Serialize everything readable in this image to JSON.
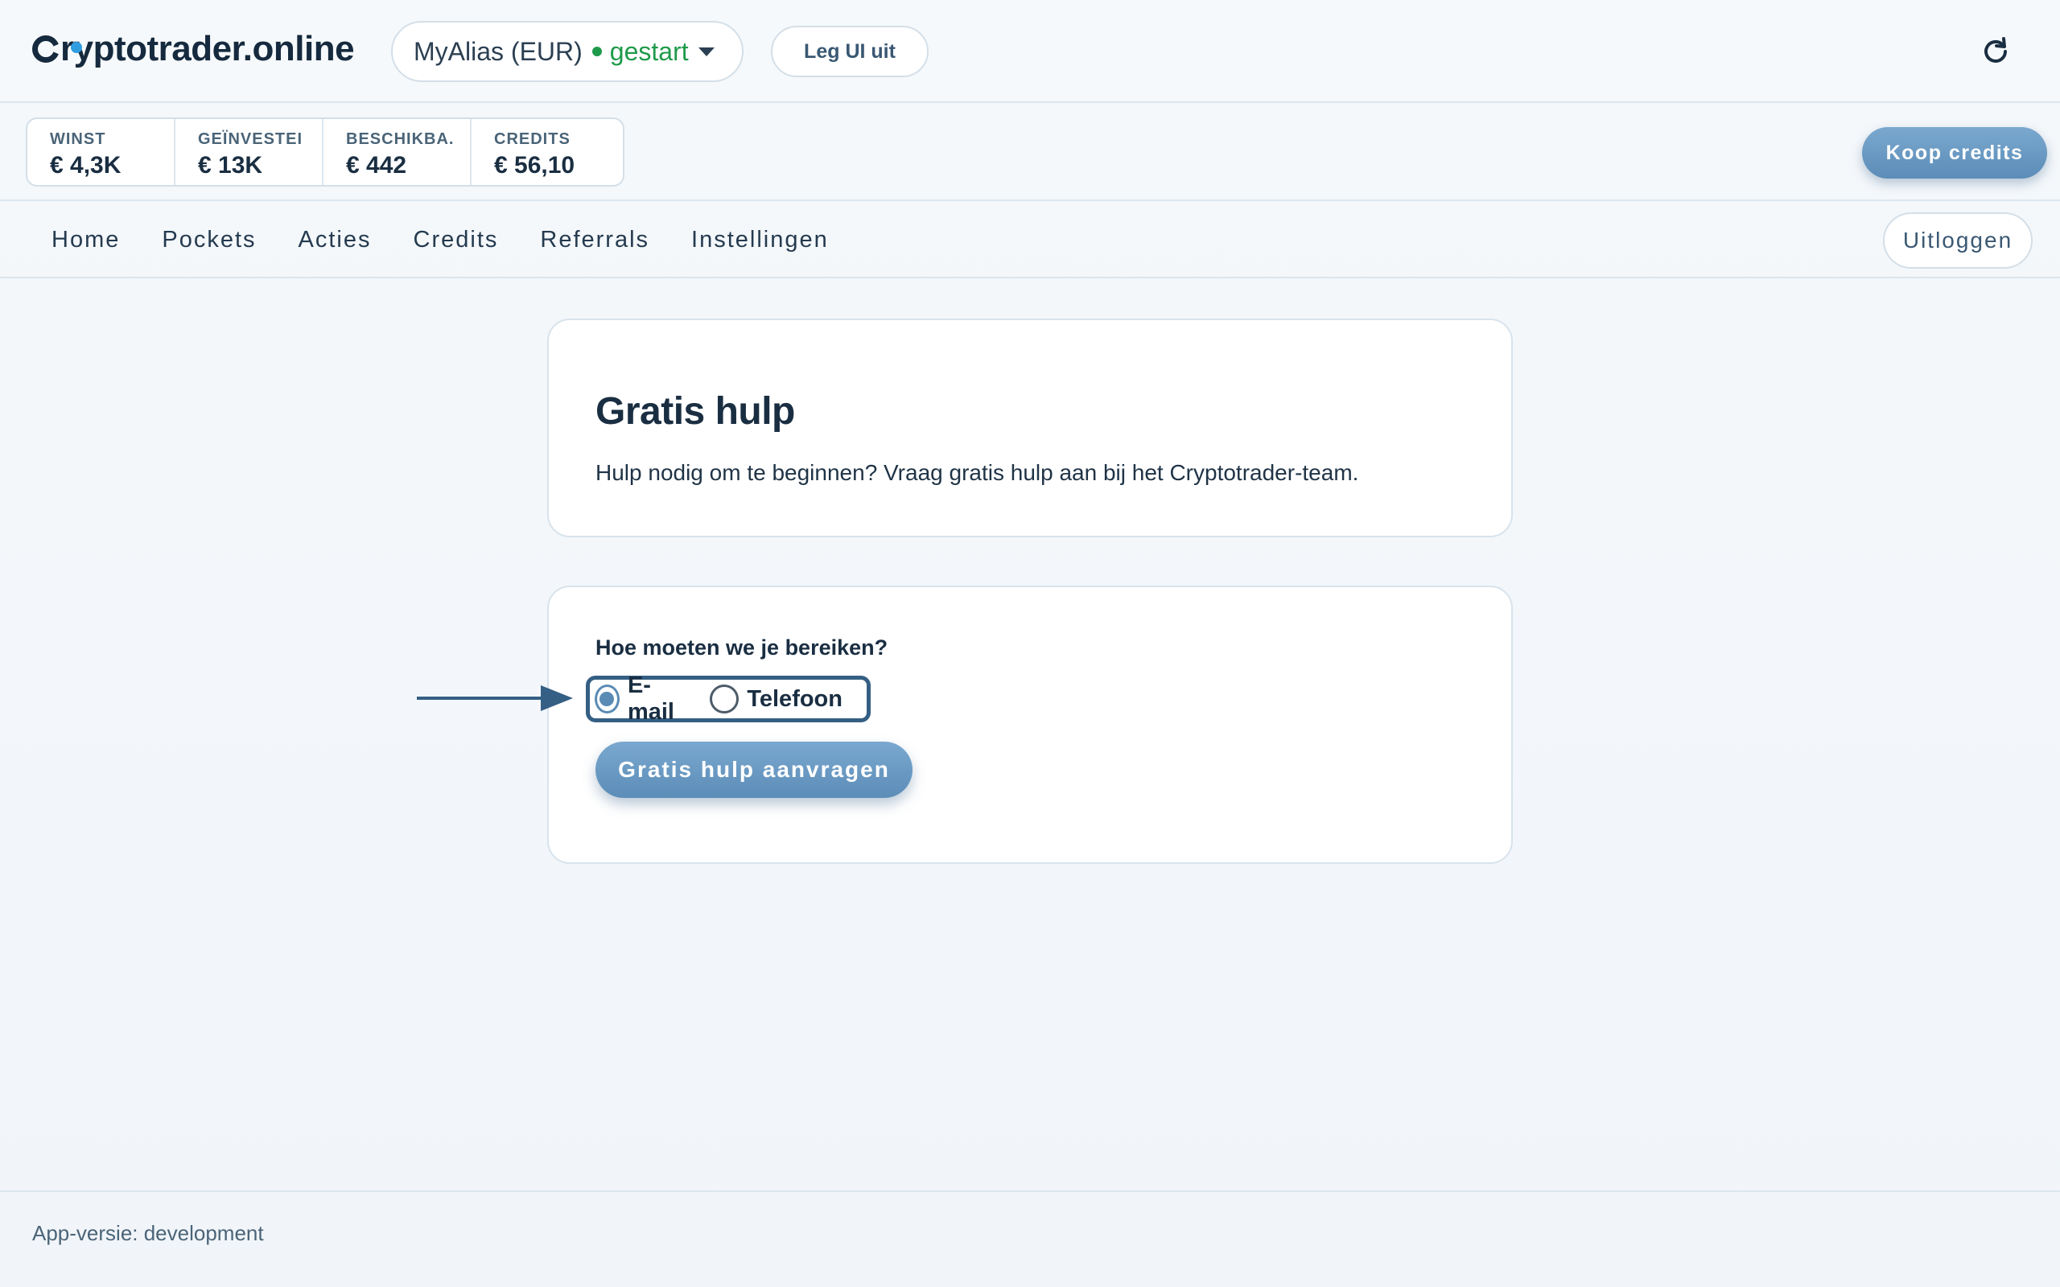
{
  "header": {
    "logo": "ryptotrader.online",
    "account": {
      "alias": "MyAlias (EUR)",
      "status": "gestart"
    },
    "explain_label": "Leg UI uit"
  },
  "stats": [
    {
      "label": "WINST",
      "value": "€ 4,3K"
    },
    {
      "label": "GEÏNVESTEI",
      "value": "€ 13K"
    },
    {
      "label": "BESCHIKBA.",
      "value": "€ 442"
    },
    {
      "label": "CREDITS",
      "value": "€ 56,10"
    }
  ],
  "buy_credits_label": "Koop credits",
  "nav": {
    "items": [
      "Home",
      "Pockets",
      "Acties",
      "Credits",
      "Referrals",
      "Instellingen"
    ],
    "logout_label": "Uitloggen"
  },
  "help_card": {
    "title": "Gratis hulp",
    "description": "Hulp nodig om te beginnen? Vraag gratis hulp aan bij het Cryptotrader-team."
  },
  "contact_card": {
    "question": "Hoe moeten we je bereiken?",
    "options": [
      {
        "label": "E-mail",
        "selected": true
      },
      {
        "label": "Telefoon",
        "selected": false
      }
    ],
    "submit_label": "Gratis hulp aanvragen"
  },
  "footer": {
    "version": "App-versie: development"
  },
  "colors": {
    "accent": "#5c8db8",
    "status_green": "#1f9a4b",
    "highlight": "#355f84"
  }
}
